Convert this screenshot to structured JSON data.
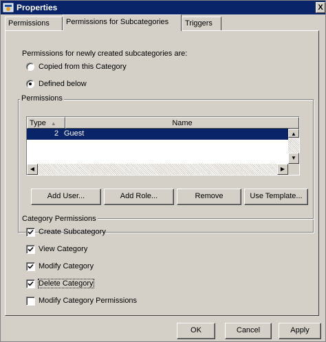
{
  "window": {
    "title": "Properties",
    "close_label": "X"
  },
  "tabs": [
    {
      "label": "Permissions"
    },
    {
      "label": "Permissions for Subcategories"
    },
    {
      "label": "Triggers"
    }
  ],
  "subcategory_section": {
    "intro": "Permissions for newly created subcategories are:",
    "options": [
      {
        "label": "Copied from this Category",
        "selected": false
      },
      {
        "label": "Defined below",
        "selected": true
      }
    ]
  },
  "permissions_group": {
    "title": "Permissions",
    "columns": [
      "Type",
      "Name"
    ],
    "rows": [
      {
        "type": "2",
        "name": "Guest"
      }
    ],
    "buttons": {
      "add_user": "Add User...",
      "add_role": "Add Role...",
      "remove": "Remove",
      "use_template": "Use Template..."
    }
  },
  "category_permissions": {
    "title": "Category Permissions",
    "items": [
      {
        "label": "Create Subcategory",
        "checked": true
      },
      {
        "label": "View Category",
        "checked": true
      },
      {
        "label": "Modify Category",
        "checked": true
      },
      {
        "label": "Delete Category",
        "checked": true
      },
      {
        "label": "Modify Category Permissions",
        "checked": false
      }
    ]
  },
  "footer_buttons": {
    "ok": "OK",
    "cancel": "Cancel",
    "apply": "Apply"
  },
  "colors": {
    "titlebar": "#0a246a",
    "selection": "#0a246a",
    "face": "#d4d0c8"
  }
}
